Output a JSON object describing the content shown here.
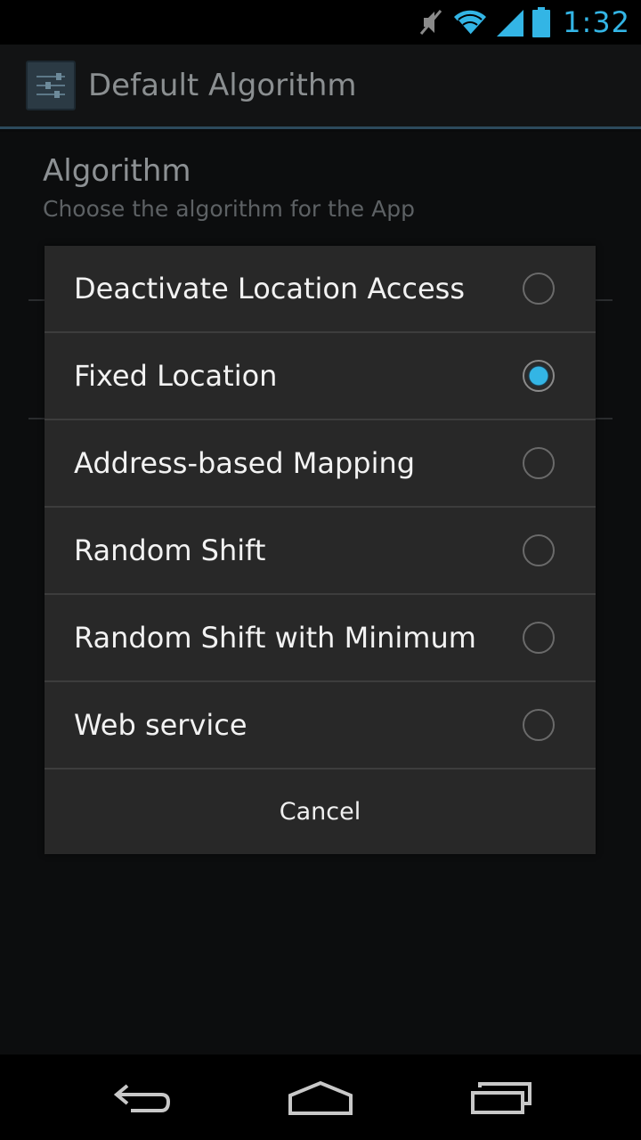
{
  "status_bar": {
    "time": "1:32",
    "icons": [
      "mute-icon",
      "wifi-icon",
      "signal-icon",
      "battery-icon"
    ]
  },
  "action_bar": {
    "title": "Default Algorithm",
    "icon": "settings-sliders-icon"
  },
  "preference": {
    "title": "Algorithm",
    "summary": "Choose the algorithm for the App"
  },
  "dialog": {
    "options": [
      {
        "label": "Deactivate Location Access",
        "checked": false
      },
      {
        "label": "Fixed Location",
        "checked": true
      },
      {
        "label": "Address-based Mapping",
        "checked": false
      },
      {
        "label": "Random Shift",
        "checked": false
      },
      {
        "label": "Random Shift with Minimum",
        "checked": false
      },
      {
        "label": "Web service",
        "checked": false
      }
    ],
    "cancel_label": "Cancel"
  },
  "nav_bar": {
    "buttons": [
      "back-icon",
      "home-icon",
      "recent-apps-icon"
    ]
  },
  "colors": {
    "accent": "#33b5e5",
    "dialog_bg": "#282828"
  }
}
